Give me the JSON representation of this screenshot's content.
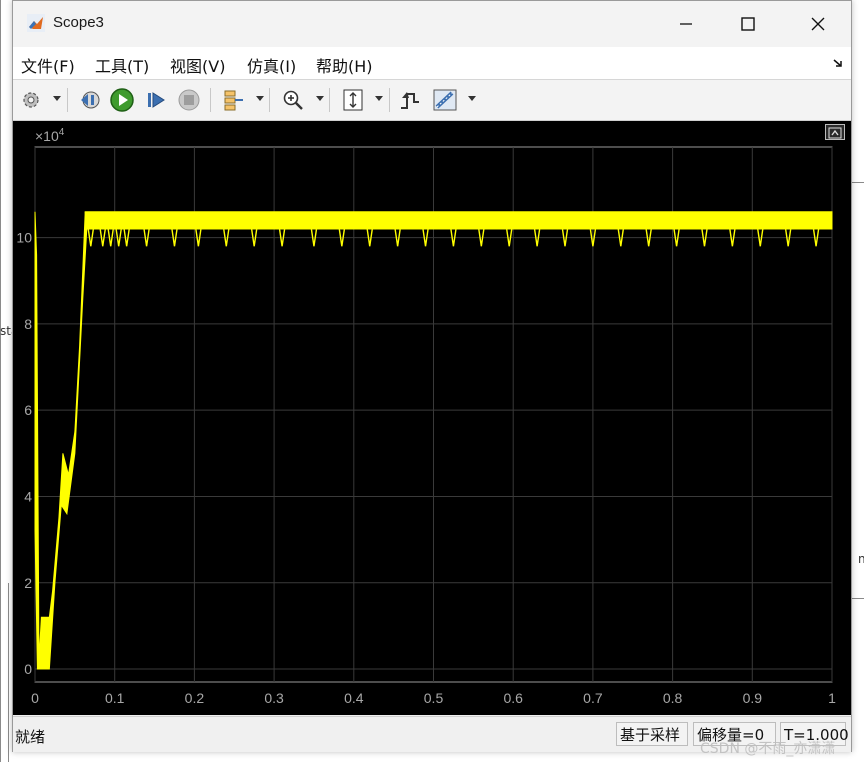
{
  "window": {
    "title": "Scope3",
    "controls": [
      "minimize-icon",
      "maximize-icon",
      "close-icon"
    ]
  },
  "menu": {
    "items": [
      {
        "id": "file",
        "label": "文件(F)"
      },
      {
        "id": "tools",
        "label": "工具(T)"
      },
      {
        "id": "view",
        "label": "视图(V)"
      },
      {
        "id": "simulation",
        "label": "仿真(I)"
      },
      {
        "id": "help",
        "label": "帮助(H)"
      }
    ]
  },
  "toolbar": {
    "icons": [
      "gear-icon",
      "step-back-icon",
      "run-icon",
      "step-forward-icon",
      "stop-icon",
      "highlight-icon",
      "zoom-in-icon",
      "autoscale-icon",
      "triggers-icon",
      "cursor-measurements-icon"
    ]
  },
  "plot": {
    "background": "#000000",
    "trace_color": "#ffff00",
    "grid_color": "#3a3a3a"
  },
  "chart_data": {
    "type": "line",
    "title": "",
    "xlabel": "",
    "ylabel": "",
    "exponent_label": "×10",
    "exponent_power": "4",
    "xlim": [
      0,
      1
    ],
    "ylim": [
      -0.3,
      12.1
    ],
    "x_ticks": [
      0,
      0.1,
      0.2,
      0.3,
      0.4,
      0.5,
      0.6,
      0.7,
      0.8,
      0.9,
      1
    ],
    "x_tick_labels": [
      "0",
      "0.1",
      "0.2",
      "0.3",
      "0.4",
      "0.5",
      "0.6",
      "0.7",
      "0.8",
      "0.9",
      "1"
    ],
    "y_ticks": [
      0,
      2,
      4,
      6,
      8,
      10
    ],
    "y_tick_labels": [
      "0",
      "2",
      "4",
      "6",
      "8",
      "10"
    ],
    "grid": true,
    "series": [
      {
        "color": "#ffff00",
        "envelope_upper": [
          [
            0,
            10.6
          ],
          [
            0.002,
            9.6
          ],
          [
            0.005,
            0.2
          ],
          [
            0.008,
            1.2
          ],
          [
            0.018,
            1.2
          ],
          [
            0.022,
            1.8
          ],
          [
            0.03,
            3.5
          ],
          [
            0.035,
            5.0
          ],
          [
            0.042,
            4.5
          ],
          [
            0.05,
            5.5
          ],
          [
            0.056,
            7.5
          ],
          [
            0.063,
            10.6
          ],
          [
            1,
            10.6
          ]
        ],
        "envelope_lower": [
          [
            0,
            3.2
          ],
          [
            0.003,
            0.0
          ],
          [
            0.018,
            0.0
          ],
          [
            0.025,
            2.0
          ],
          [
            0.033,
            3.8
          ],
          [
            0.04,
            3.6
          ],
          [
            0.05,
            5.0
          ],
          [
            0.06,
            8.6
          ],
          [
            0.065,
            10.2
          ],
          [
            1,
            10.2
          ]
        ],
        "dips": [
          0.07,
          0.085,
          0.095,
          0.105,
          0.115,
          0.14,
          0.175,
          0.205,
          0.24,
          0.275,
          0.31,
          0.35,
          0.385,
          0.42,
          0.455,
          0.49,
          0.525,
          0.56,
          0.595,
          0.63,
          0.665,
          0.7,
          0.735,
          0.77,
          0.805,
          0.84,
          0.875,
          0.91,
          0.945,
          0.98
        ],
        "dip_min": 9.8
      }
    ]
  },
  "status": {
    "ready": "就绪",
    "mode": "基于采样",
    "offset": "偏移量=0",
    "time": "T=1.000"
  },
  "watermark": "CSDN @不雨_亦潇潇",
  "backdrop": {
    "fragment_left": "sta",
    "fragment_right": "n"
  }
}
